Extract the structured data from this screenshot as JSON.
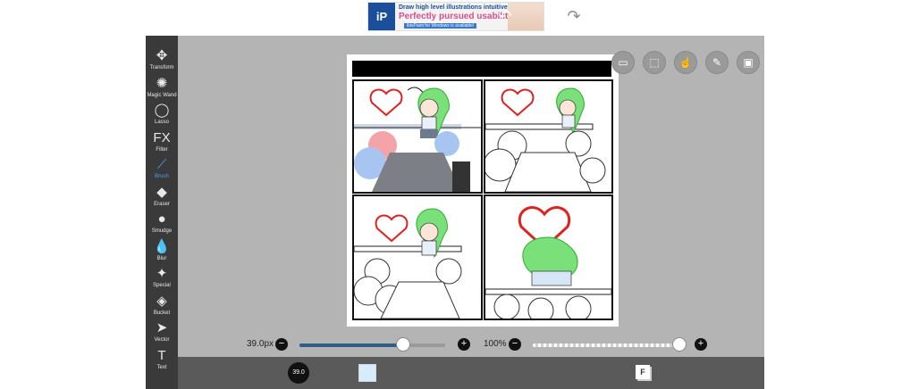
{
  "ad": {
    "logo": "iP",
    "line1": "Draw high level illustrations intuitively!",
    "line2": "Perfectly pursued usability!",
    "line3": "ibisPaint for Windows is available!"
  },
  "tools": [
    {
      "label": "Transform",
      "icon": "transform-icon",
      "glyph": "✥"
    },
    {
      "label": "Magic Wand",
      "icon": "magic-wand-icon",
      "glyph": "✺"
    },
    {
      "label": "Lasso",
      "icon": "lasso-icon",
      "glyph": "◯"
    },
    {
      "label": "Filter",
      "icon": "filter-icon",
      "glyph": "FX"
    },
    {
      "label": "Brush",
      "icon": "brush-icon",
      "glyph": "⟋"
    },
    {
      "label": "Eraser",
      "icon": "eraser-icon",
      "glyph": "◆"
    },
    {
      "label": "Smudge",
      "icon": "smudge-icon",
      "glyph": "●"
    },
    {
      "label": "Blur",
      "icon": "blur-icon",
      "glyph": "💧"
    },
    {
      "label": "Special",
      "icon": "special-icon",
      "glyph": "✦"
    },
    {
      "label": "Bucket",
      "icon": "bucket-icon",
      "glyph": "◈"
    },
    {
      "label": "Vector",
      "icon": "vector-icon",
      "glyph": "➤"
    },
    {
      "label": "Text",
      "icon": "text-icon",
      "glyph": "T"
    }
  ],
  "active_tool": "Brush",
  "brush_size": {
    "value": "39.0px",
    "minus": "−",
    "plus": "+",
    "fraction": 0.71
  },
  "opacity": {
    "value": "100%",
    "minus": "−",
    "plus": "+",
    "fraction": 1.0
  },
  "bottom": {
    "brush_size_badge": "39.0",
    "layer_badge": "F"
  },
  "colors": {
    "accent": "#4aa3e8",
    "toolbar_bg": "#3a3a3a",
    "bottombar_bg": "#5a5a5a",
    "canvas_bg": "#b4b4b4",
    "current_color": "#d6ecfa",
    "hair_green": "#79e07a"
  },
  "comic": {
    "love_text": "Love"
  }
}
